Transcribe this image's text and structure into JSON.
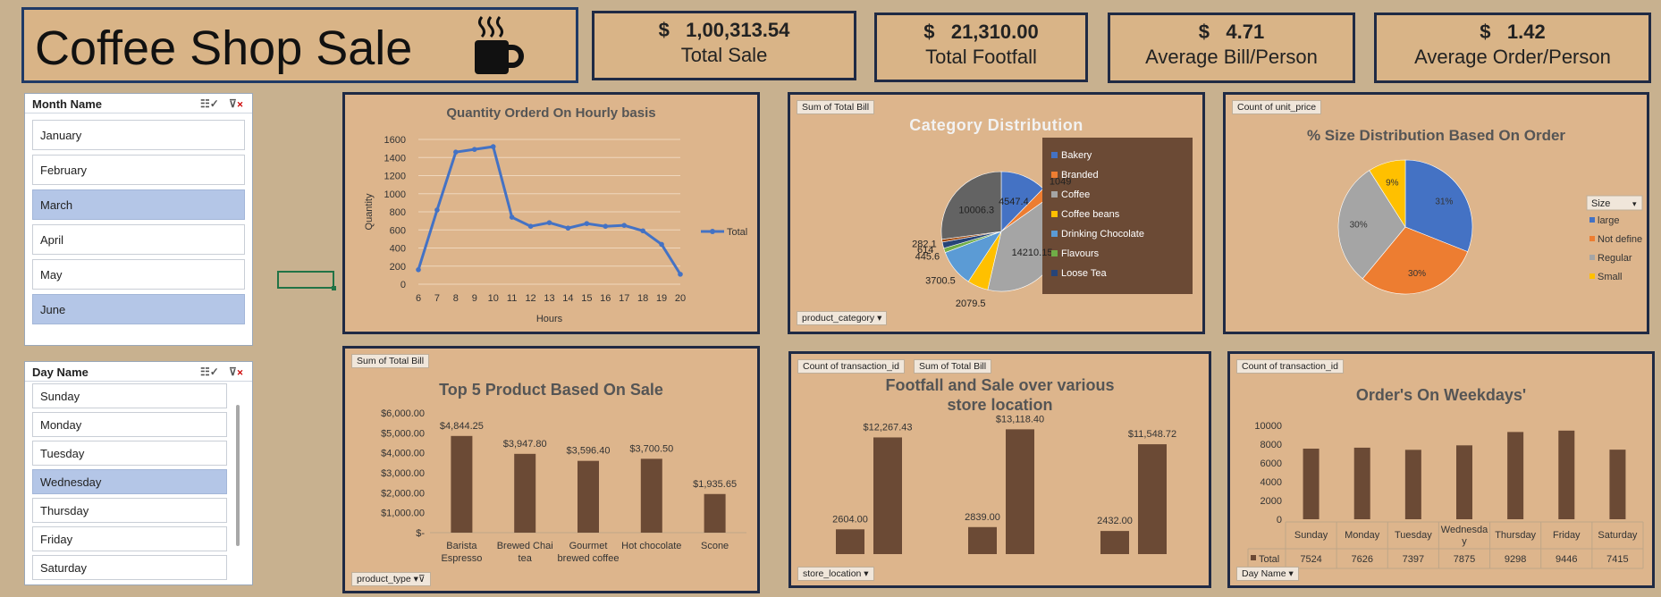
{
  "title": "Coffee Shop Sale",
  "kpis": [
    {
      "value": "$   1,00,313.54",
      "label": "Total Sale"
    },
    {
      "value": "$   21,310.00",
      "label": "Total Footfall"
    },
    {
      "value": "$   4.71",
      "label": "Average Bill/Person"
    },
    {
      "value": "$   1.42",
      "label": "Average Order/Person"
    }
  ],
  "month_slicer": {
    "header": "Month Name",
    "items": [
      {
        "label": "January",
        "selected": false
      },
      {
        "label": "February",
        "selected": false
      },
      {
        "label": "March",
        "selected": true
      },
      {
        "label": "April",
        "selected": false
      },
      {
        "label": "May",
        "selected": false
      },
      {
        "label": "June",
        "selected": true
      }
    ]
  },
  "day_slicer": {
    "header": "Day Name",
    "items": [
      {
        "label": "Sunday",
        "selected": false
      },
      {
        "label": "Monday",
        "selected": false
      },
      {
        "label": "Tuesday",
        "selected": false
      },
      {
        "label": "Wednesday",
        "selected": true
      },
      {
        "label": "Thursday",
        "selected": false
      },
      {
        "label": "Friday",
        "selected": false
      },
      {
        "label": "Saturday",
        "selected": false
      }
    ]
  },
  "icons": {
    "coffee": "coffee-mug-icon",
    "multiselect": "multi-select-icon",
    "clear_filter": "clear-filter-icon",
    "dropdown": "dropdown-arrow-icon"
  },
  "colors": {
    "background": "#c8b18f",
    "panel": "#ddb58c",
    "border": "#1f2a44",
    "line": "#4472c4",
    "bar": "#6b4a35",
    "slicer_selected": "#b4c6e7"
  },
  "chart_data": [
    {
      "type": "line",
      "title": "Quantity Orderd On Hourly basis",
      "xlabel": "Hours",
      "ylabel": "Quantity",
      "ylim": [
        0,
        1600
      ],
      "yticks": [
        0,
        200,
        400,
        600,
        800,
        1000,
        1200,
        1400,
        1600
      ],
      "x": [
        6,
        7,
        8,
        9,
        10,
        11,
        12,
        13,
        14,
        15,
        16,
        17,
        18,
        19,
        20
      ],
      "series": [
        {
          "name": "Total",
          "values": [
            160,
            820,
            1460,
            1490,
            1520,
            740,
            640,
            680,
            620,
            670,
            640,
            650,
            590,
            440,
            110
          ]
        }
      ],
      "legend": "right",
      "grid": true
    },
    {
      "type": "pie",
      "title": "Category Distribution",
      "field_tag": "Sum of Total Bill",
      "filter_tag": "product_category",
      "categories": [
        "Bakery",
        "Branded",
        "Coffee",
        "Coffee beans",
        "Drinking Chocolate",
        "Flavours",
        "Loose Tea"
      ],
      "values": [
        4547.4,
        1049,
        14210.15,
        2079.5,
        3700.5,
        445.6,
        614
      ],
      "slices": [
        {
          "category": "Bakery",
          "value": 4547.4,
          "label": "4547.4",
          "color": "#4472c4"
        },
        {
          "category": "Branded",
          "value": 1049,
          "label": "1049",
          "color": "#ed7d31"
        },
        {
          "category": "Coffee",
          "value": 14210.15,
          "label": "14210.15",
          "color": "#a5a5a5"
        },
        {
          "category": "Coffee beans",
          "value": 2079.5,
          "label": "2079.5",
          "color": "#ffc000"
        },
        {
          "category": "Drinking Chocolate",
          "value": 3700.5,
          "label": "3700.5",
          "color": "#5b9bd5"
        },
        {
          "category": "Flavours",
          "value": 445.6,
          "label": "445.6",
          "color": "#70ad47"
        },
        {
          "category": "Loose Tea",
          "value": 614,
          "label": "614",
          "color": "#264478"
        },
        {
          "category": "",
          "value": 282.1,
          "label": "282.1",
          "color": "#9e480e"
        },
        {
          "category": "",
          "value": 10006.3,
          "label": "10006.3",
          "color": "#636363"
        }
      ],
      "legend": "right"
    },
    {
      "type": "pie",
      "title": "% Size Distribution Based On Order",
      "field_tag": "Count of unit_price",
      "legend_title": "Size",
      "categories": [
        "large",
        "Not define",
        "Regular",
        "Small"
      ],
      "values": [
        31,
        30,
        30,
        9
      ],
      "labels": [
        "31%",
        "30%",
        "30%",
        "9%"
      ],
      "colors": [
        "#4472c4",
        "#ed7d31",
        "#a5a5a5",
        "#ffc000"
      ],
      "legend": "right"
    },
    {
      "type": "bar",
      "title": "Top 5 Product Based On Sale",
      "field_tag": "Sum of Total Bill",
      "filter_tag": "product_type",
      "categories": [
        "Barista Espresso",
        "Brewed Chai tea",
        "Gourmet brewed coffee",
        "Hot chocolate",
        "Scone"
      ],
      "values": [
        4844.25,
        3947.8,
        3596.4,
        3700.5,
        1935.65
      ],
      "labels": [
        "$4,844.25",
        "$3,947.80",
        "$3,596.40",
        "$3,700.50",
        "$1,935.65"
      ],
      "ylim": [
        0,
        6000
      ],
      "yticks": [
        "$-",
        "$1,000.00",
        "$2,000.00",
        "$3,000.00",
        "$4,000.00",
        "$5,000.00",
        "$6,000.00"
      ]
    },
    {
      "type": "bar",
      "title": "Footfall and Sale over various store location",
      "field_tags": [
        "Count of transaction_id",
        "Sum of Total Bill"
      ],
      "filter_tag": "store_location",
      "series": [
        {
          "name": "Count of transaction_id",
          "values": [
            2604,
            2839,
            2432
          ],
          "labels": [
            "2604.00",
            "2839.00",
            "2432.00"
          ]
        },
        {
          "name": "Sum of Total Bill",
          "values": [
            12267.43,
            13118.4,
            11548.72
          ],
          "labels": [
            "$12,267.43",
            "$13,118.40",
            "$11,548.72"
          ]
        }
      ]
    },
    {
      "type": "bar",
      "title": "Order's On Weekdays'",
      "field_tag": "Count of transaction_id",
      "filter_tag": "Day Name",
      "categories": [
        "Sunday",
        "Monday",
        "Tuesday",
        "Wednesday",
        "Thursday",
        "Friday",
        "Saturday"
      ],
      "category_labels": [
        "Sunday",
        "Monday",
        "Tuesday",
        "Wednesda y",
        "Thursday",
        "Friday",
        "Saturday"
      ],
      "series": [
        {
          "name": "Total",
          "values": [
            7524,
            7626,
            7397,
            7875,
            9298,
            9446,
            7415
          ]
        }
      ],
      "ylim": [
        0,
        10000
      ],
      "yticks": [
        0,
        2000,
        4000,
        6000,
        8000,
        10000
      ],
      "data_table": true
    }
  ]
}
